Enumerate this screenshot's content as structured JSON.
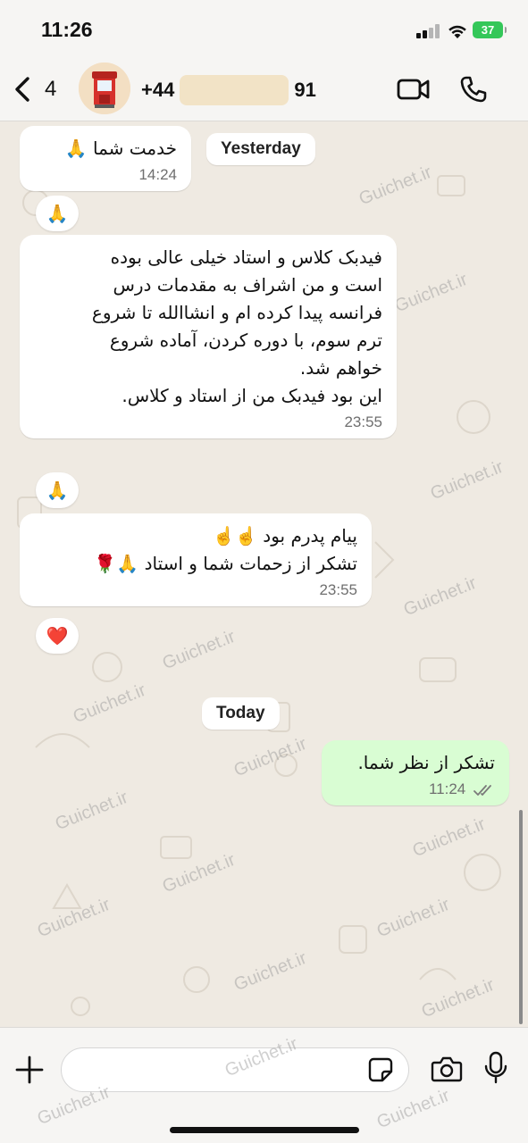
{
  "status_bar": {
    "time": "11:26",
    "battery": "37",
    "battery_color": "#34c759"
  },
  "header": {
    "back_count": "4",
    "contact_prefix": "+44",
    "contact_suffix": "91",
    "icons": [
      "chevron-left-icon",
      "video-call-icon",
      "phone-icon"
    ]
  },
  "chat": {
    "watermark": "Guichet.ir",
    "date_yesterday": "Yesterday",
    "date_today": "Today",
    "messages": [
      {
        "direction": "in",
        "text": "خدمت شما 🙏",
        "time": "14:24",
        "reaction": "🙏"
      },
      {
        "direction": "in",
        "lines": [
          "فیدبک کلاس و استاد خیلی عالی بوده",
          "است و من اشراف به مقدمات درس",
          "فرانسه پیدا کرده ام و انشاالله تا شروع",
          "ترم سوم، با دوره کردن، آماده شروع",
          "خواهم شد.",
          "این بود فیدبک من از استاد و کلاس."
        ],
        "time": "23:55",
        "reaction": "🙏"
      },
      {
        "direction": "in",
        "lines": [
          "پیام پدرم بود ☝️☝️",
          "تشکر از زحمات شما و استاد 🙏🌹"
        ],
        "time": "23:55",
        "reaction": "❤️"
      },
      {
        "direction": "out",
        "text": "تشکر از نظر شما.",
        "time": "11:24",
        "status": "read"
      }
    ]
  },
  "input_bar": {
    "placeholder": ""
  },
  "colors": {
    "outgoing_bubble": "#d9fdd3",
    "incoming_bubble": "#ffffff",
    "chat_background": "#efeae2",
    "read_ticks": "#7a7a7a"
  }
}
